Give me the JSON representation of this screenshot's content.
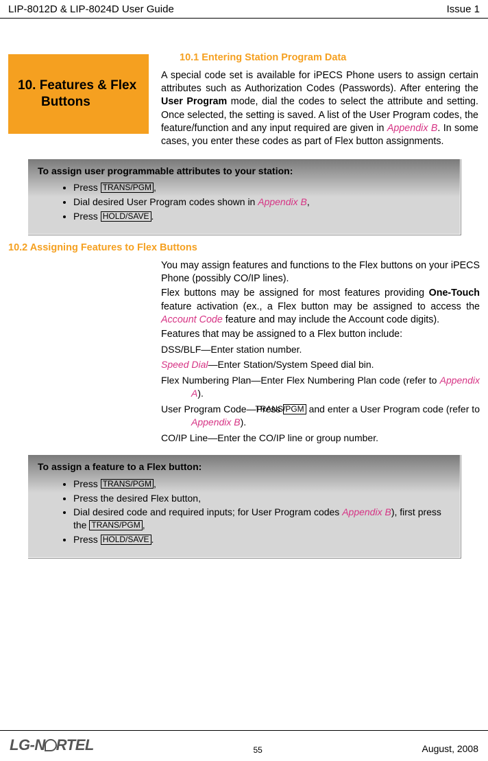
{
  "header": {
    "left": "LIP-8012D & LIP-8024D User Guide",
    "right": "Issue 1"
  },
  "sidebar_box": {
    "line1": "10. Features & Flex",
    "line2": "Buttons"
  },
  "section1": {
    "heading": "10.1   Entering Station Program Data",
    "para_a": "A special code set is available for iPECS Phone users to assign certain attributes such as Authorization Codes (Passwords).  After entering the ",
    "para_b_bold": "User Program",
    "para_c": " mode, dial the codes to select the attribute and setting.  Once selected, the setting is saved.  A list of the User Program codes, the feature/function and any input required are given in ",
    "para_d_appendix": "Appendix B",
    "para_e": ".  In some cases, you enter these codes as part of Flex button assignments."
  },
  "box1": {
    "title": "To assign user programmable attributes to your station:",
    "items": {
      "i1a": "Press ",
      "i1key": "TRANS/PGM",
      "i1b": ",",
      "i2a": "Dial desired User Program codes shown in ",
      "i2app": "Appendix B",
      "i2b": ",",
      "i3a": "Press ",
      "i3key": "HOLD/SAVE",
      "i3b": "."
    }
  },
  "section2": {
    "heading": "10.2   Assigning Features to Flex Buttons",
    "p1": "You may assign features and functions to the Flex buttons on your iPECS Phone (possibly CO/IP lines).",
    "p2a": "Flex buttons may be assigned for most features providing ",
    "p2b_bold": "One-Touch",
    "p2c": " feature activation (ex., a Flex button may be assigned to access the ",
    "p2d_acct": "Account Code",
    "p2e": " feature and may include the Account code digits).",
    "p3": "Features that may be assigned to a Flex button include:",
    "features": {
      "f1": "DSS/BLF—Enter station number.",
      "f2a": "Speed Dial",
      "f2b": "—Enter Station/System Speed dial bin.",
      "f3a": "Flex Numbering Plan—Enter Flex Numbering Plan code (refer to ",
      "f3app": "Appendix A",
      "f3b": ").",
      "f4a": "User Program Code—Press ",
      "f4key": "TRANS/PGM",
      "f4b": " and enter a User Program code (refer to ",
      "f4app": "Appendix B",
      "f4c": ").",
      "f5": "CO/IP Line—Enter the CO/IP line or group number."
    }
  },
  "box2": {
    "title": "To assign a feature to a Flex button:",
    "items": {
      "i1a": "Press ",
      "i1key": "TRANS/PGM",
      "i1b": ",",
      "i2": "Press the desired Flex button,",
      "i3a": "Dial desired code and required inputs; for User Program codes ",
      "i3app": "Appendix B",
      "i3b": "), first press the ",
      "i3key": "TRANS/PGM",
      "i3c": ",",
      "i4a": "Press ",
      "i4key": "HOLD/SAVE",
      "i4b": "."
    }
  },
  "footer": {
    "logo_a": "LG-N",
    "logo_b": "RTEL",
    "page": "55",
    "date": "August, 2008"
  }
}
